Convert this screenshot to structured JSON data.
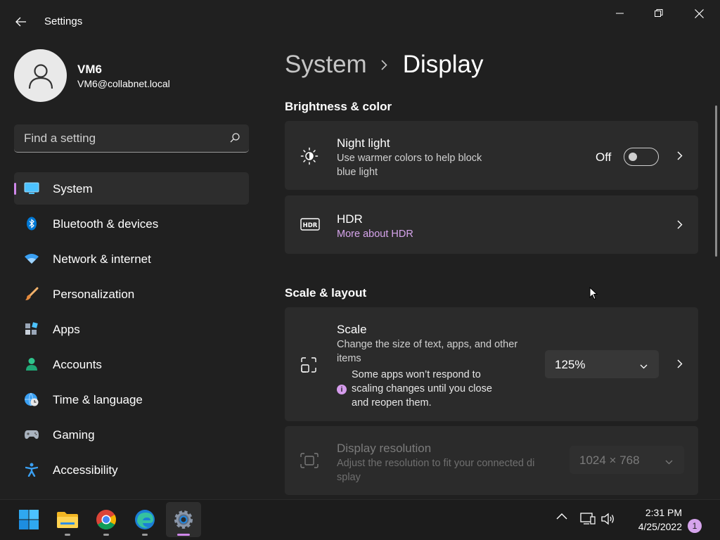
{
  "window": {
    "app_title": "Settings",
    "user": {
      "name": "VM6",
      "email": "VM6@collabnet.local"
    },
    "search": {
      "placeholder": "Find a setting"
    }
  },
  "sidebar": {
    "items": [
      {
        "label": "System",
        "icon": "monitor-icon",
        "active": true
      },
      {
        "label": "Bluetooth & devices",
        "icon": "bluetooth-icon"
      },
      {
        "label": "Network & internet",
        "icon": "wifi-icon"
      },
      {
        "label": "Personalization",
        "icon": "brush-icon"
      },
      {
        "label": "Apps",
        "icon": "apps-icon"
      },
      {
        "label": "Accounts",
        "icon": "person-icon"
      },
      {
        "label": "Time & language",
        "icon": "globe-clock-icon"
      },
      {
        "label": "Gaming",
        "icon": "gamepad-icon"
      },
      {
        "label": "Accessibility",
        "icon": "accessibility-icon"
      }
    ]
  },
  "main": {
    "breadcrumb": {
      "parent": "System",
      "current": "Display"
    },
    "sections": {
      "brightness": "Brightness & color",
      "scale_layout": "Scale & layout"
    },
    "night_light": {
      "title": "Night light",
      "subtitle_line1": "Use warmer colors to help block",
      "subtitle_line2": "blue light",
      "state": "Off"
    },
    "hdr": {
      "title": "HDR",
      "link": "More about HDR"
    },
    "scale": {
      "title": "Scale",
      "subtitle_line1": "Change the size of text, apps, and other",
      "subtitle_line2": "items",
      "info_line1": "Some apps won’t respond to",
      "info_line2": "scaling changes until you close",
      "info_line3": "and reopen them.",
      "value": "125%"
    },
    "resolution": {
      "title": "Display resolution",
      "subtitle_line1": "Adjust the resolution to fit your connected di",
      "subtitle_line2": "splay",
      "value": "1024 × 768"
    }
  },
  "taskbar": {
    "apps": [
      "start-icon",
      "file-explorer-icon",
      "chrome-icon",
      "edge-icon",
      "settings-icon"
    ],
    "time": "2:31 PM",
    "date": "4/25/2022",
    "notification_count": "1"
  },
  "colors": {
    "accent": "#cf87ea",
    "link": "#d6a4ec",
    "background": "#202020",
    "card": "#2b2b2b"
  }
}
